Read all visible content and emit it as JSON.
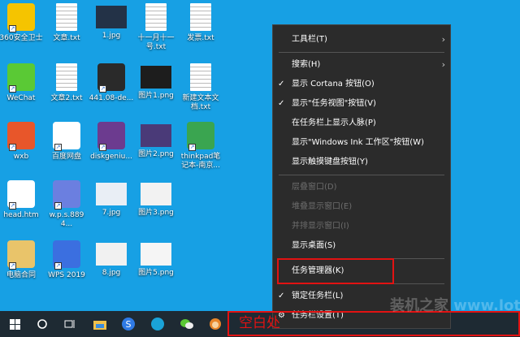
{
  "desktop_icons": [
    {
      "label": "360安全卫士",
      "type": "app",
      "color": "#f5c400"
    },
    {
      "label": "文章.txt",
      "type": "doc"
    },
    {
      "label": "1.jpg",
      "type": "img",
      "color": "#233247"
    },
    {
      "label": "十一月十一号.txt",
      "type": "doc"
    },
    {
      "label": "发票.txt",
      "type": "doc"
    },
    {
      "label": "WeChat",
      "type": "app",
      "color": "#5ac935"
    },
    {
      "label": "文章2.txt",
      "type": "doc"
    },
    {
      "label": "441.08-de...",
      "type": "app",
      "color": "#2a2a2a"
    },
    {
      "label": "图片1.png",
      "type": "img",
      "color": "#1d1d1d"
    },
    {
      "label": "新建文本文档.txt",
      "type": "doc"
    },
    {
      "label": "wxb",
      "type": "app",
      "color": "#e8562a"
    },
    {
      "label": "百度网盘",
      "type": "app",
      "color": "#ffffff"
    },
    {
      "label": "diskgeniu...",
      "type": "app",
      "color": "#6c3b8f"
    },
    {
      "label": "图片2.png",
      "type": "img",
      "color": "#4a3a78"
    },
    {
      "label": "thinkpad笔记本-南京...",
      "type": "app",
      "color": "#3aa550"
    },
    {
      "label": "head.htm",
      "type": "app",
      "color": "#ffffff"
    },
    {
      "label": "w.p.s.8894...",
      "type": "app",
      "color": "#6b7fe0"
    },
    {
      "label": "7.jpg",
      "type": "img",
      "color": "#e9eef5"
    },
    {
      "label": "图片3.png",
      "type": "img",
      "color": "#f2f2f2"
    },
    {
      "label": "电脑合同",
      "type": "app",
      "color": "#e9c46a"
    },
    {
      "label": "WPS 2019",
      "type": "app",
      "color": "#3b6fe0"
    },
    {
      "label": "8.jpg",
      "type": "img",
      "color": "#f1f1f1"
    },
    {
      "label": "图片5.png",
      "type": "img",
      "color": "#f5f5f5"
    }
  ],
  "menu": {
    "toolbar": "工具栏(T)",
    "search": "搜索(H)",
    "cortana": "显示 Cortana 按钮(O)",
    "taskview": "显示\"任务视图\"按钮(V)",
    "people": "在任务栏上显示人脉(P)",
    "ink": "显示\"Windows Ink 工作区\"按钮(W)",
    "touch": "显示触摸键盘按钮(Y)",
    "cascade": "层叠窗口(D)",
    "stack": "堆叠显示窗口(E)",
    "side": "并排显示窗口(I)",
    "desktop": "显示桌面(S)",
    "taskmgr": "任务管理器(K)",
    "lock": "锁定任务栏(L)",
    "settings": "任务栏设置(T)"
  },
  "annotation": {
    "label": "空白处",
    "color": "#e21212"
  },
  "watermark": "装机之家 www.lotpc.com",
  "taskbar": {
    "icons": [
      "windows-start",
      "cortana-search",
      "task-view",
      "file-explorer",
      "sogou-browser",
      "lotpc-app",
      "wechat",
      "wxb"
    ]
  }
}
